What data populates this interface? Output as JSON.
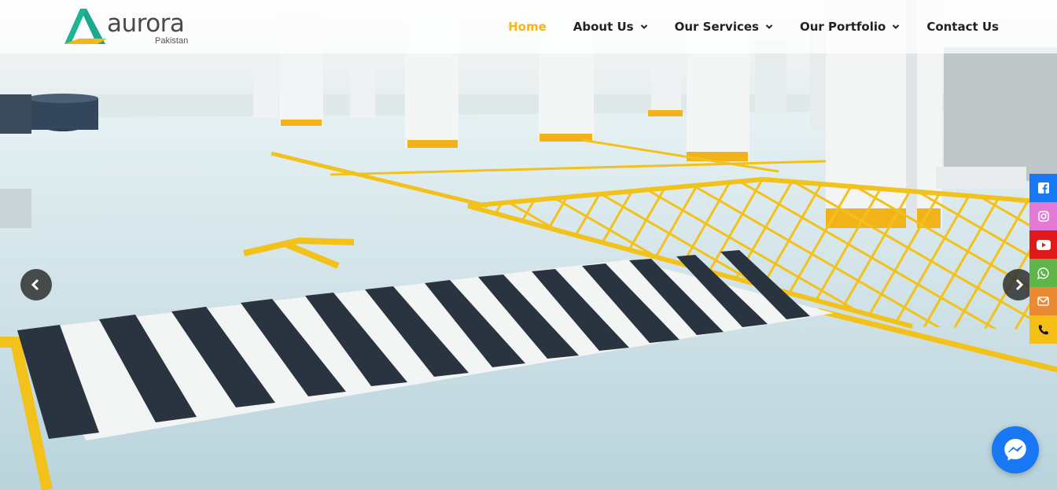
{
  "brand": {
    "name": "aurora",
    "subtitle": "Pakistan",
    "logo_colors": [
      "#1aa88f",
      "#f5b51b"
    ]
  },
  "nav": {
    "items": [
      {
        "label": "Home",
        "active": true,
        "has_dropdown": false
      },
      {
        "label": "About Us",
        "active": false,
        "has_dropdown": true
      },
      {
        "label": "Our Services",
        "active": false,
        "has_dropdown": true
      },
      {
        "label": "Our Portfolio",
        "active": false,
        "has_dropdown": true
      },
      {
        "label": "Contact Us",
        "active": false,
        "has_dropdown": false
      }
    ],
    "active_color": "#f5b51b"
  },
  "slider": {
    "prev_icon": "chevron-left-icon",
    "next_icon": "chevron-right-icon"
  },
  "social": [
    {
      "name": "facebook-icon",
      "color": "#1877f2"
    },
    {
      "name": "instagram-icon",
      "color": "#e57ad6"
    },
    {
      "name": "youtube-icon",
      "color": "#e01818"
    },
    {
      "name": "whatsapp-icon",
      "color": "#5fb548"
    },
    {
      "name": "email-icon",
      "color": "#ec8a33"
    },
    {
      "name": "phone-icon",
      "color": "#f5bf16"
    }
  ],
  "messenger": {
    "icon": "messenger-icon",
    "color": "#1877f2"
  }
}
